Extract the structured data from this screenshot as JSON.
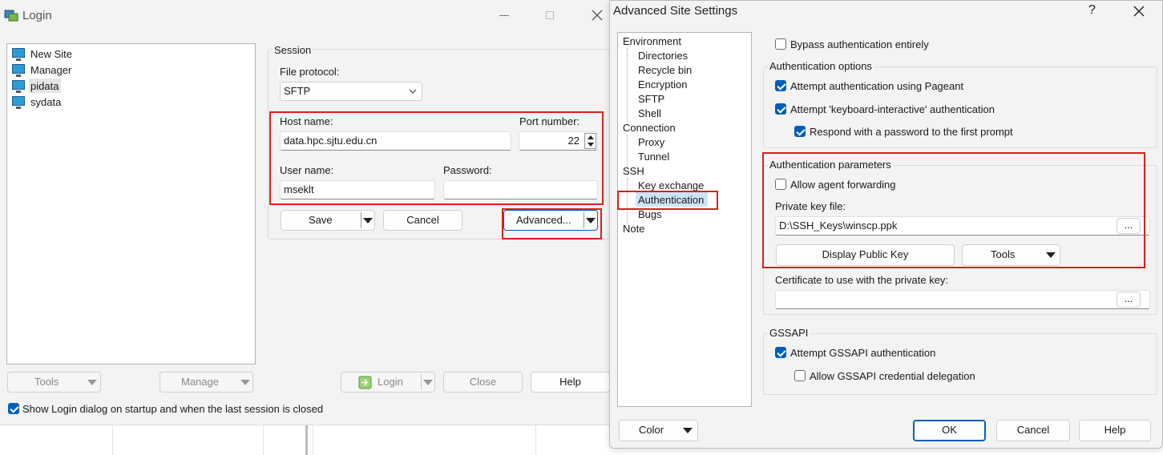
{
  "login": {
    "title": "Login",
    "sites": [
      "New Site",
      "Manager",
      "pidata",
      "sydata"
    ],
    "session_label": "Session",
    "file_protocol_label": "File protocol:",
    "file_protocol_value": "SFTP",
    "host_label": "Host name:",
    "host_value": "data.hpc.sjtu.edu.cn",
    "port_label": "Port number:",
    "port_value": "22",
    "user_label": "User name:",
    "user_value": "mseklt",
    "password_label": "Password:",
    "password_value": "",
    "save": "Save",
    "cancel": "Cancel",
    "advanced": "Advanced...",
    "tools": "Tools",
    "manage": "Manage",
    "login_btn": "Login",
    "close": "Close",
    "help": "Help",
    "show_login_label": "Show Login dialog on startup and when the last session is closed",
    "show_login_checked": true
  },
  "advanced": {
    "title": "Advanced Site Settings",
    "help_glyph": "?",
    "tree": {
      "environment": "Environment",
      "directories": "Directories",
      "recycle_bin": "Recycle bin",
      "encryption": "Encryption",
      "sftp": "SFTP",
      "shell": "Shell",
      "connection": "Connection",
      "proxy": "Proxy",
      "tunnel": "Tunnel",
      "ssh": "SSH",
      "key_exchange": "Key exchange",
      "authentication": "Authentication",
      "bugs": "Bugs",
      "note": "Note"
    },
    "bypass_auth": {
      "label": "Bypass authentication entirely",
      "checked": false
    },
    "auth_options_title": "Authentication options",
    "attempt_pageant": {
      "label": "Attempt authentication using Pageant",
      "checked": true
    },
    "attempt_ki": {
      "label": "Attempt 'keyboard-interactive' authentication",
      "checked": true
    },
    "respond_password": {
      "label": "Respond with a password to the first prompt",
      "checked": true
    },
    "auth_params_title": "Authentication parameters",
    "allow_agent": {
      "label": "Allow agent forwarding",
      "checked": false
    },
    "private_key_label": "Private key file:",
    "private_key_value": "D:\\SSH_Keys\\winscp.ppk",
    "browse": "...",
    "display_public_key": "Display Public Key",
    "tools": "Tools",
    "cert_label": "Certificate to use with the private key:",
    "cert_value": "",
    "gssapi_title": "GSSAPI",
    "attempt_gssapi": {
      "label": "Attempt GSSAPI authentication",
      "checked": true
    },
    "allow_gssapi_deleg": {
      "label": "Allow GSSAPI credential delegation",
      "checked": false
    },
    "color": "Color",
    "ok": "OK",
    "cancel": "Cancel",
    "help": "Help"
  }
}
